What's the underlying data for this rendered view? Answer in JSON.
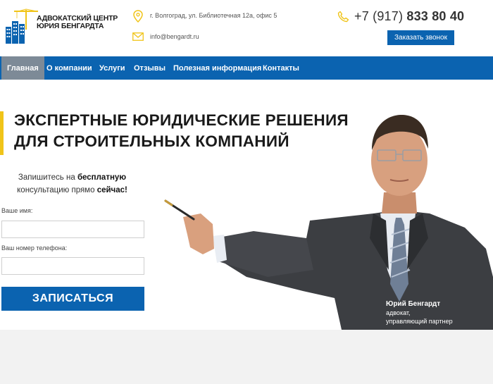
{
  "header": {
    "logo_line1": "АДВОКАТСКИЙ ЦЕНТР",
    "logo_line2": "ЮРИЯ БЕНГАРДТА",
    "address": "г. Волгоград, ул. Библиотечная 12а, офис 5",
    "email": "info@bengardt.ru",
    "phone_prefix": "+7 (917)",
    "phone_number": "833 80 40",
    "callback_label": "Заказать звонок"
  },
  "nav": {
    "items": [
      {
        "label": "Главная",
        "active": true
      },
      {
        "label": "О компании"
      },
      {
        "label": "Услуги"
      },
      {
        "label": "Отзывы"
      },
      {
        "label": "Полезная информация"
      },
      {
        "label": "Контакты"
      }
    ]
  },
  "hero": {
    "headline_line1": "ЭКСПЕРТНЫЕ ЮРИДИЧЕСКИЕ РЕШЕНИЯ",
    "headline_line2": "ДЛЯ СТРОИТЕЛЬНЫХ КОМПАНИЙ",
    "cta_part1": "Запишитесь на ",
    "cta_bold1": "бесплатную",
    "cta_part2": "консультацию прямо ",
    "cta_bold2": "сейчас!",
    "name_label": "Ваше имя:",
    "phone_label": "Ваш номер телефона:",
    "submit_label": "ЗАПИСАТЬСЯ",
    "person_name": "Юрий Бенгардт",
    "person_role1": "адвокат,",
    "person_role2": "управляющий партнер"
  },
  "colors": {
    "brand_blue": "#0b63b0",
    "accent_yellow": "#f0c419",
    "nav_active": "#7d8a97"
  },
  "icons": {
    "address": "map-pin-icon",
    "email": "envelope-icon",
    "phone": "phone-icon"
  }
}
